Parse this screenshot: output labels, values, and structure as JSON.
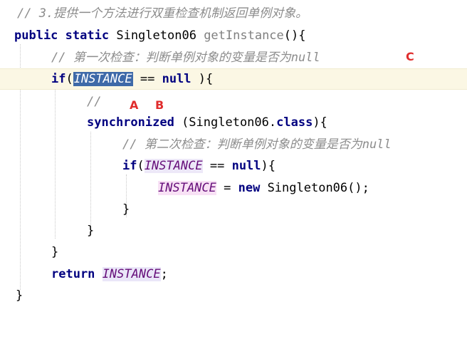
{
  "code": {
    "comment_top": "// 3.提供一个方法进行双重检查机制返回单例对象。",
    "signature": {
      "kw_public": "public",
      "kw_static": "static",
      "type": "Singleton06",
      "method": "getInstance",
      "parens": "(){"
    },
    "comment_first": "// 第一次检查：判断单例对象的变量是否为null",
    "if1": {
      "kw": "if",
      "open": "(",
      "field": "INSTANCE",
      "op": " == ",
      "null_kw": "null",
      "close": " ){"
    },
    "empty_comment": "//",
    "sync": {
      "kw": "synchronized",
      "open": " (Singleton06.",
      "class_kw": "class",
      "close": "){"
    },
    "comment_second": "// 第二次检查：判断单例对象的变量是否为null",
    "if2": {
      "kw": "if",
      "open": "(",
      "field": "INSTANCE",
      "op": " == ",
      "null_kw": "null",
      "close": "){"
    },
    "assign": {
      "field": "INSTANCE",
      "eq": " = ",
      "new_kw": "new",
      "ctor": " Singleton06();"
    },
    "brace_inner": "}",
    "brace_sync": "}",
    "brace_if": "}",
    "ret": {
      "kw": "return",
      "field": "INSTANCE",
      "semi": ";"
    },
    "brace_method": "}"
  },
  "annotations": {
    "a": "A",
    "b": "B",
    "c": "C"
  }
}
